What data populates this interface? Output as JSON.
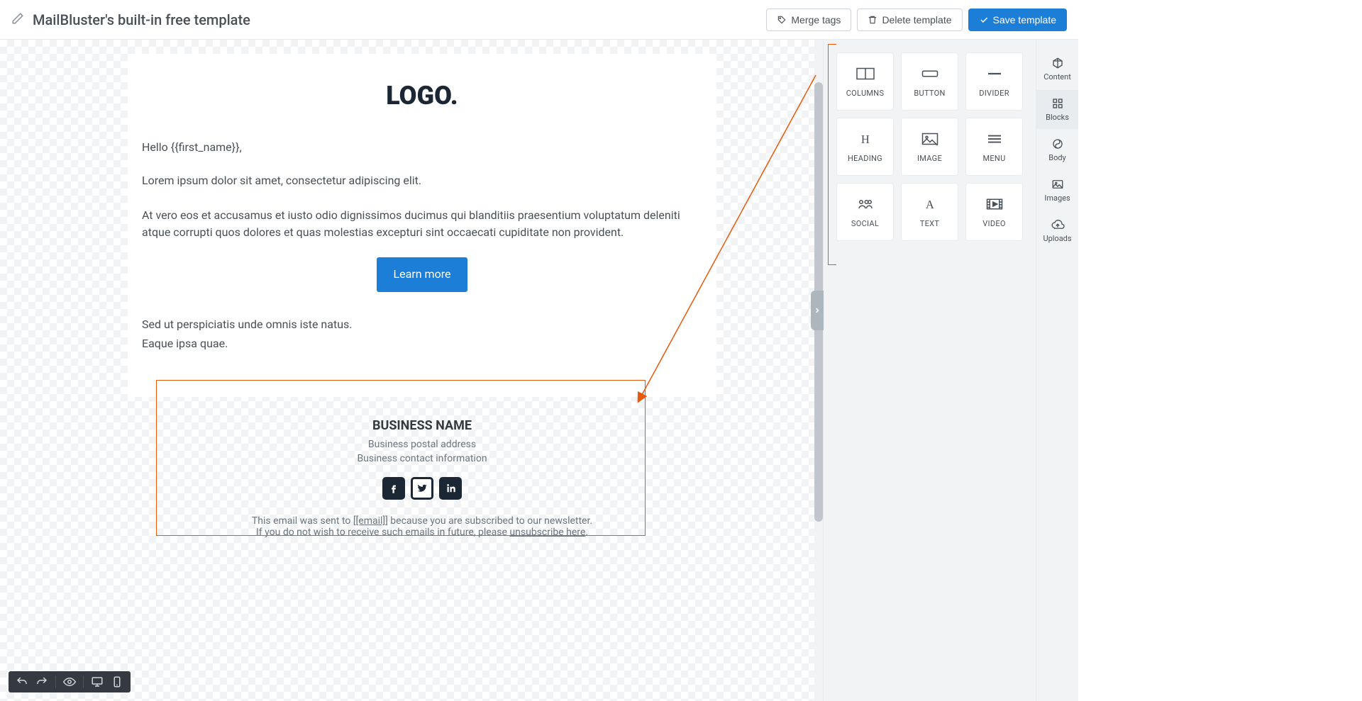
{
  "header": {
    "title": "MailBluster's built-in free template",
    "buttons": {
      "merge_tags": "Merge tags",
      "delete_template": "Delete template",
      "save_template": "Save template"
    }
  },
  "email": {
    "logo": "LOGO.",
    "greeting": "Hello {{first_name}},",
    "para1": "Lorem ipsum dolor sit amet, consectetur adipiscing elit.",
    "para2": "At vero eos et accusamus et iusto odio dignissimos ducimus qui blanditiis praesentium voluptatum deleniti atque corrupti quos dolores et quas molestias excepturi sint occaecati cupiditate non provident.",
    "cta": "Learn more",
    "para3a": "Sed ut perspiciatis unde omnis iste natus.",
    "para3b": "Eaque ipsa quae."
  },
  "footer": {
    "business_name": "BUSINESS NAME",
    "postal": "Business postal address",
    "contact": "Business contact information",
    "fine1_a": "This email was sent to ",
    "fine1_link": "[[email]]",
    "fine1_b": " because you are subscribed to our newsletter.",
    "fine2_a": "If you do not wish to receive such emails in future, please ",
    "fine2_link": "unsubscribe here",
    "fine2_b": "."
  },
  "blocks": {
    "items": [
      "COLUMNS",
      "BUTTON",
      "DIVIDER",
      "HEADING",
      "IMAGE",
      "MENU",
      "SOCIAL",
      "TEXT",
      "VIDEO"
    ]
  },
  "rail": {
    "items": [
      "Content",
      "Blocks",
      "Body",
      "Images",
      "Uploads"
    ],
    "active_index": 1
  }
}
